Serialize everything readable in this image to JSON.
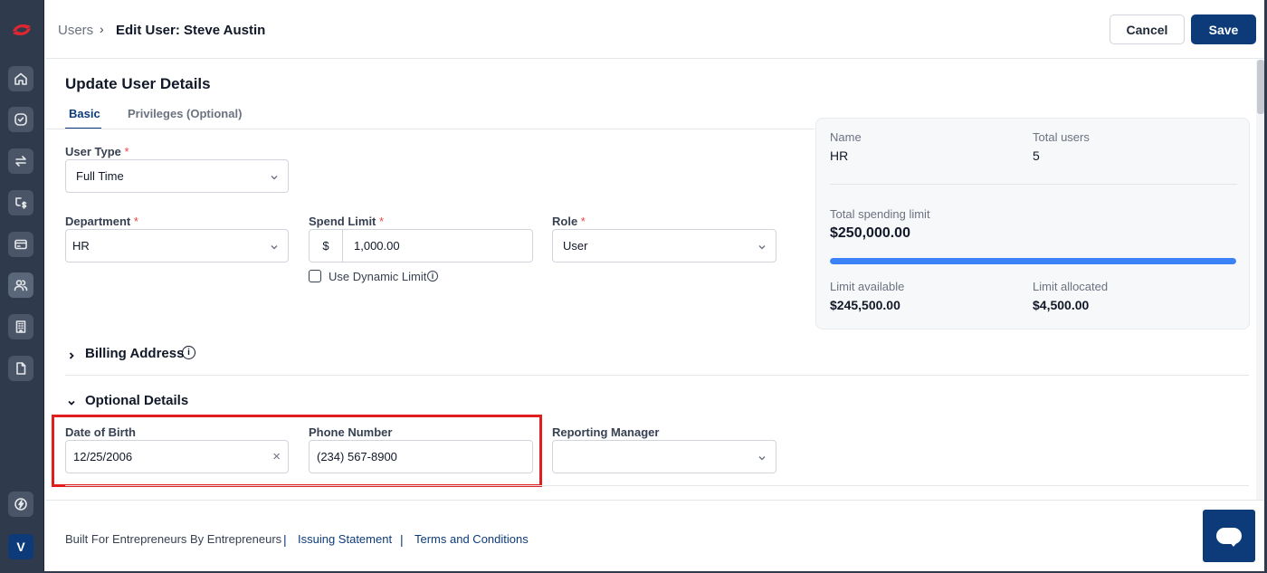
{
  "sidebar": {
    "items": [
      {
        "icon": "home-icon"
      },
      {
        "icon": "check-circle-icon"
      },
      {
        "icon": "transfer-icon"
      },
      {
        "icon": "expense-flow-icon"
      },
      {
        "icon": "card-icon"
      },
      {
        "icon": "users-icon",
        "active": true
      },
      {
        "icon": "building-icon"
      },
      {
        "icon": "document-icon"
      }
    ],
    "bottom_icon": "lightning-icon",
    "avatar_initial": "V"
  },
  "header": {
    "breadcrumb_parent": "Users",
    "breadcrumb_separator": "›",
    "breadcrumb_current": "Edit User: Steve Austin",
    "cancel_label": "Cancel",
    "save_label": "Save"
  },
  "main": {
    "title": "Update User Details",
    "tabs": [
      {
        "label": "Basic",
        "active": true
      },
      {
        "label": "Privileges (Optional)",
        "active": false
      }
    ],
    "form": {
      "user_type": {
        "label": "User Type",
        "required_mark": "*",
        "value": "Full Time"
      },
      "department": {
        "label": "Department",
        "required_mark": "*",
        "value": "HR"
      },
      "spend_limit": {
        "label": "Spend Limit",
        "required_mark": "*",
        "currency": "$",
        "value": "1,000.00"
      },
      "role": {
        "label": "Role",
        "required_mark": "*",
        "value": "User"
      },
      "dynamic_limit": {
        "label": "Use Dynamic Limit",
        "checked": false,
        "info": "i"
      }
    },
    "summary_card": {
      "name_label": "Name",
      "name_value": "HR",
      "total_users_label": "Total users",
      "total_users_value": "5",
      "total_spending_label": "Total spending limit",
      "total_spending_value": "$250,000.00",
      "progress_fraction": 1.0,
      "limit_available_label": "Limit available",
      "limit_available_value": "$245,500.00",
      "limit_allocated_label": "Limit allocated",
      "limit_allocated_value": "$4,500.00"
    },
    "billing_section": {
      "title": "Billing Address",
      "expanded": false,
      "info": "i"
    },
    "optional_section": {
      "title": "Optional Details",
      "expanded": true,
      "dob": {
        "label": "Date of Birth",
        "value": "12/25/2006",
        "clear": "×"
      },
      "phone": {
        "label": "Phone Number",
        "value": "(234) 567-8900"
      },
      "reporting_manager": {
        "label": "Reporting Manager",
        "value": ""
      }
    },
    "highlight_color": "#e11d1d"
  },
  "footer": {
    "tagline": "Built For Entrepreneurs By Entrepreneurs",
    "separator": "|",
    "link_issuing": "Issuing Statement",
    "link_terms": "Terms and Conditions"
  },
  "colors": {
    "brand": "#0d3b7a",
    "sidebar": "#2f3b4d",
    "progress": "#3b82f6",
    "required": "#ef4444"
  }
}
